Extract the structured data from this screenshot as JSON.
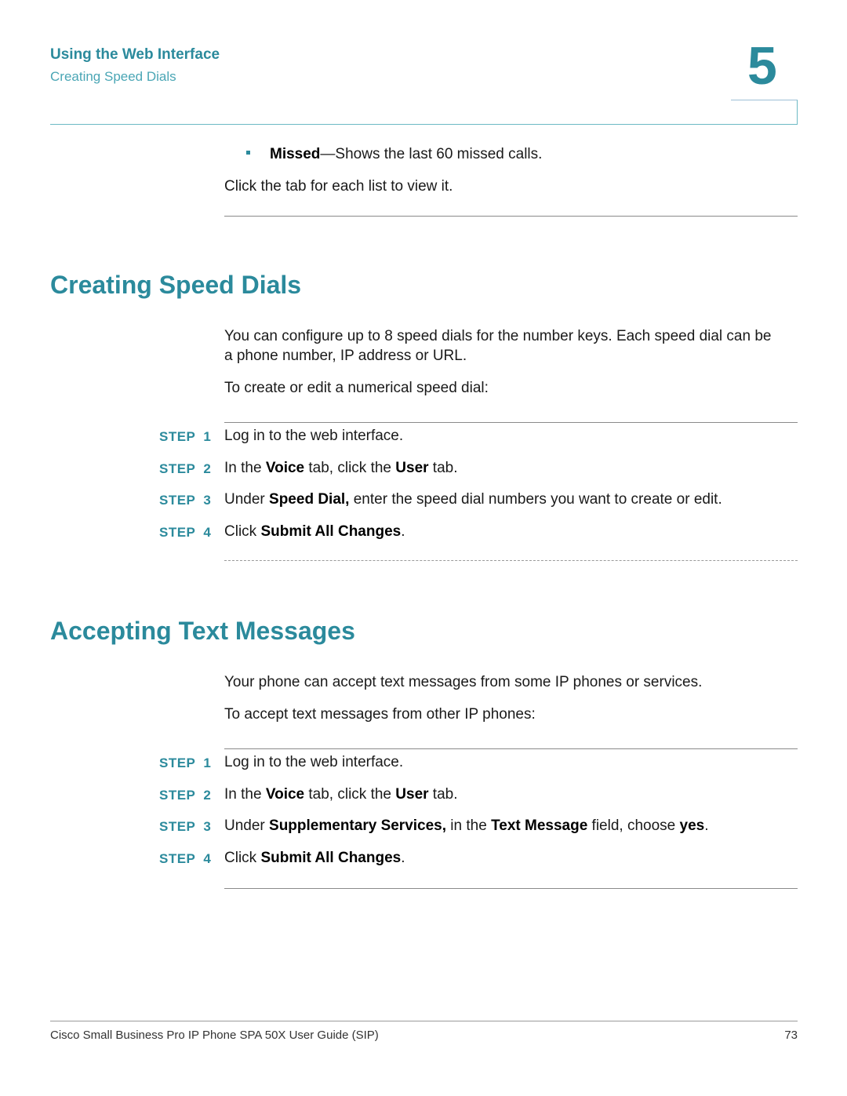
{
  "header": {
    "chapter_title": "Using the Web Interface",
    "section_title": "Creating Speed Dials",
    "chapter_number": "5"
  },
  "intro": {
    "bullet_term": "Missed",
    "bullet_text": "—Shows the last 60 missed calls.",
    "note": "Click the tab for each list to view it."
  },
  "section1": {
    "title": "Creating Speed Dials",
    "para1": "You can configure up to 8 speed dials for the number keys. Each speed dial can be",
    "para1_line2": "a phone number, IP address or URL.",
    "para2": "To create or edit a numerical speed dial:",
    "steps": [
      {
        "label": "STEP",
        "num": "1",
        "parts": [
          {
            "t": "Log in to the web interface.",
            "b": false
          }
        ]
      },
      {
        "label": "STEP",
        "num": "2",
        "parts": [
          {
            "t": "In the ",
            "b": false
          },
          {
            "t": "Voice",
            "b": true
          },
          {
            "t": " tab, click the ",
            "b": false
          },
          {
            "t": "User",
            "b": true
          },
          {
            "t": " tab.",
            "b": false
          }
        ]
      },
      {
        "label": "STEP",
        "num": "3",
        "parts": [
          {
            "t": "Under ",
            "b": false
          },
          {
            "t": "Speed Dial,",
            "b": true
          },
          {
            "t": " enter the speed dial numbers you want to create or edit.",
            "b": false
          }
        ]
      },
      {
        "label": "STEP",
        "num": "4",
        "parts": [
          {
            "t": "Click ",
            "b": false
          },
          {
            "t": "Submit All Changes",
            "b": true
          },
          {
            "t": ".",
            "b": false
          }
        ]
      }
    ]
  },
  "section2": {
    "title": "Accepting Text Messages",
    "para1": "Your phone can accept text messages from some IP phones or services.",
    "para2": "To accept text messages from other IP phones:",
    "steps": [
      {
        "label": "STEP",
        "num": "1",
        "parts": [
          {
            "t": "Log in to the web interface.",
            "b": false
          }
        ]
      },
      {
        "label": "STEP",
        "num": "2",
        "parts": [
          {
            "t": "In the ",
            "b": false
          },
          {
            "t": "Voice",
            "b": true
          },
          {
            "t": " tab, click the ",
            "b": false
          },
          {
            "t": "User",
            "b": true
          },
          {
            "t": " tab.",
            "b": false
          }
        ]
      },
      {
        "label": "STEP",
        "num": "3",
        "parts": [
          {
            "t": "Under ",
            "b": false
          },
          {
            "t": "Supplementary Services,",
            "b": true
          },
          {
            "t": " in the ",
            "b": false
          },
          {
            "t": "Text Message",
            "b": true
          },
          {
            "t": " field, choose ",
            "b": false
          },
          {
            "t": "yes",
            "b": true
          },
          {
            "t": ".",
            "b": false
          }
        ]
      },
      {
        "label": "STEP",
        "num": "4",
        "parts": [
          {
            "t": "Click ",
            "b": false
          },
          {
            "t": "Submit All Changes",
            "b": true
          },
          {
            "t": ".",
            "b": false
          }
        ]
      }
    ]
  },
  "footer": {
    "doc_title": "Cisco Small Business Pro IP Phone SPA 50X User Guide (SIP)",
    "page_number": "73"
  }
}
